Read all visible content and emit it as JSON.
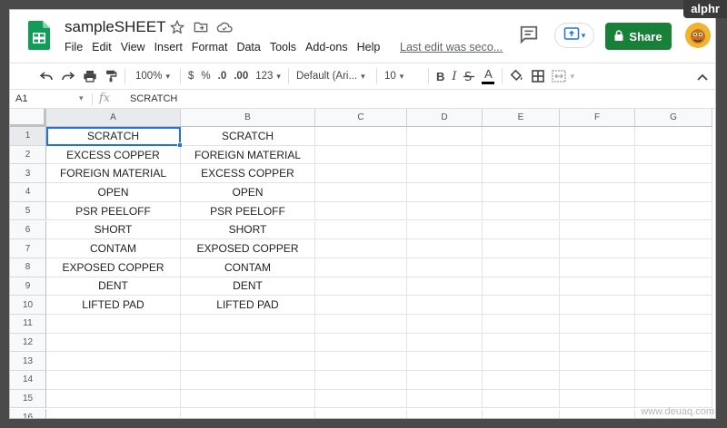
{
  "app": {
    "title": "sampleSHEET",
    "last_edit": "Last edit was seco...",
    "share_label": "Share",
    "accent": "#188038",
    "selection_color": "#1a73e8"
  },
  "menu": [
    "File",
    "Edit",
    "View",
    "Insert",
    "Format",
    "Data",
    "Tools",
    "Add-ons",
    "Help"
  ],
  "toolbar": {
    "zoom": "100%",
    "currency": "$",
    "percent": "%",
    "decimal_decrease": ".0",
    "decimal_increase": ".00",
    "more_formats": "123",
    "font": "Default (Ari...",
    "font_size": "10",
    "bold": "B",
    "italic": "I",
    "text_color": "A"
  },
  "formula_bar": {
    "cell_ref": "A1",
    "fx": "fx",
    "value": "SCRATCH"
  },
  "columns": [
    "A",
    "B",
    "C",
    "D",
    "E",
    "F",
    "G"
  ],
  "rows": [
    "1",
    "2",
    "3",
    "4",
    "5",
    "6",
    "7",
    "8",
    "9",
    "10",
    "11",
    "12",
    "13",
    "14",
    "15",
    "16"
  ],
  "cells": [
    [
      "SCRATCH",
      "SCRATCH"
    ],
    [
      "EXCESS COPPER",
      "FOREIGN MATERIAL"
    ],
    [
      "FOREIGN MATERIAL",
      "EXCESS COPPER"
    ],
    [
      "OPEN",
      "OPEN"
    ],
    [
      "PSR PEELOFF",
      "PSR PEELOFF"
    ],
    [
      "SHORT",
      "SHORT"
    ],
    [
      "CONTAM",
      "EXPOSED COPPER"
    ],
    [
      "EXPOSED COPPER",
      "CONTAM"
    ],
    [
      "DENT",
      "DENT"
    ],
    [
      "LIFTED PAD",
      "LIFTED PAD"
    ]
  ],
  "watermarks": {
    "top": "alphr",
    "bottom": "www.deuaq.com"
  }
}
